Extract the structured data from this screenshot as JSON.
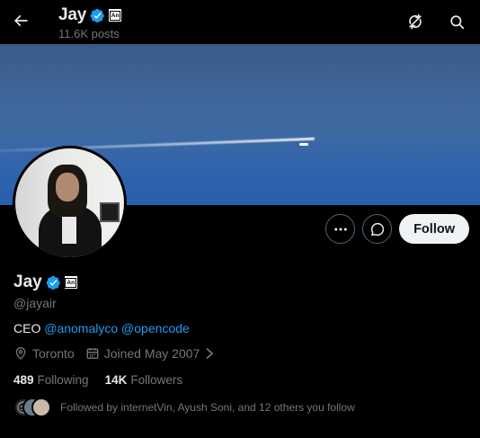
{
  "header": {
    "title": "Jay",
    "post_count": "11.6K posts",
    "affiliate_badge": "An"
  },
  "icons": {
    "back": "arrow-left-icon",
    "refresh": "refresh-icon",
    "search": "search-icon",
    "more": "more-icon",
    "message": "message-icon",
    "verified": "verified-icon",
    "location": "location-icon",
    "calendar": "calendar-icon"
  },
  "actions": {
    "follow_label": "Follow"
  },
  "profile": {
    "name": "Jay",
    "affiliate_badge": "An",
    "handle": "@jayair",
    "bio_prefix": "CEO",
    "bio_link_1": "@anomalyco",
    "bio_link_2": "@opencode",
    "location": "Toronto",
    "joined": "Joined May 2007",
    "following_count": "489",
    "following_label": "Following",
    "followers_count": "14K",
    "followers_label": "Followers",
    "followed_by": "Followed by internetVin, Ayush Soni, and 12 others you follow"
  },
  "colors": {
    "accent": "#1d9bf0",
    "background": "#000000",
    "muted": "#71767b",
    "text": "#e7e9ea"
  }
}
